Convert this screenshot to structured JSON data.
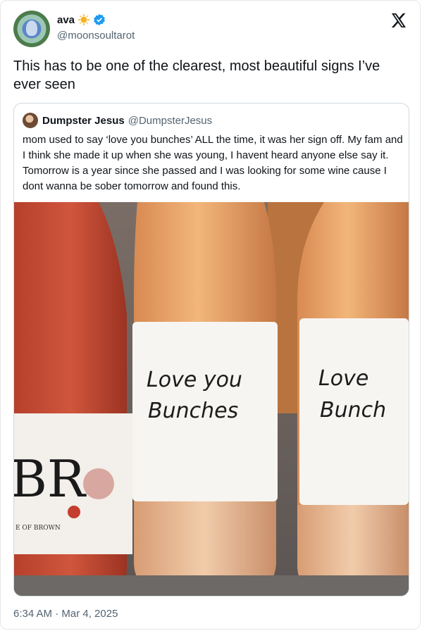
{
  "author": {
    "display_name": "ava",
    "handle": "@moonsoultarot",
    "badges": [
      "sun-emoji",
      "verified-badge"
    ]
  },
  "tweet": {
    "text": "This has to be one of the clearest, most beautiful signs I’ve ever seen",
    "timestamp": "6:34 AM · Mar 4, 2025"
  },
  "quoted_tweet": {
    "display_name": "Dumpster Jesus",
    "handle": "@DumpsterJesus",
    "text": "mom used to say ‘love you bunches’ ALL the time, it was her sign off. My fam and I think she made it up when she was young, I havent heard anyone else say it. Tomorrow is a year since she passed and I was looking for some wine cause I dont wanna be sober tomorrow and found this.",
    "photo": {
      "bottle_label_center_line1": "Love you",
      "bottle_label_center_line2": "Bunches",
      "bottle_label_right_line1": "Love",
      "bottle_label_right_line2": "Bunch",
      "brand_letters": "BR",
      "brand_footer": "E OF BROWN"
    }
  },
  "icons": {
    "close": "x-logo-icon"
  },
  "colors": {
    "text_primary": "#0f1419",
    "text_secondary": "#536471",
    "border": "#cfd9de",
    "verified": "#1d9bf0"
  }
}
